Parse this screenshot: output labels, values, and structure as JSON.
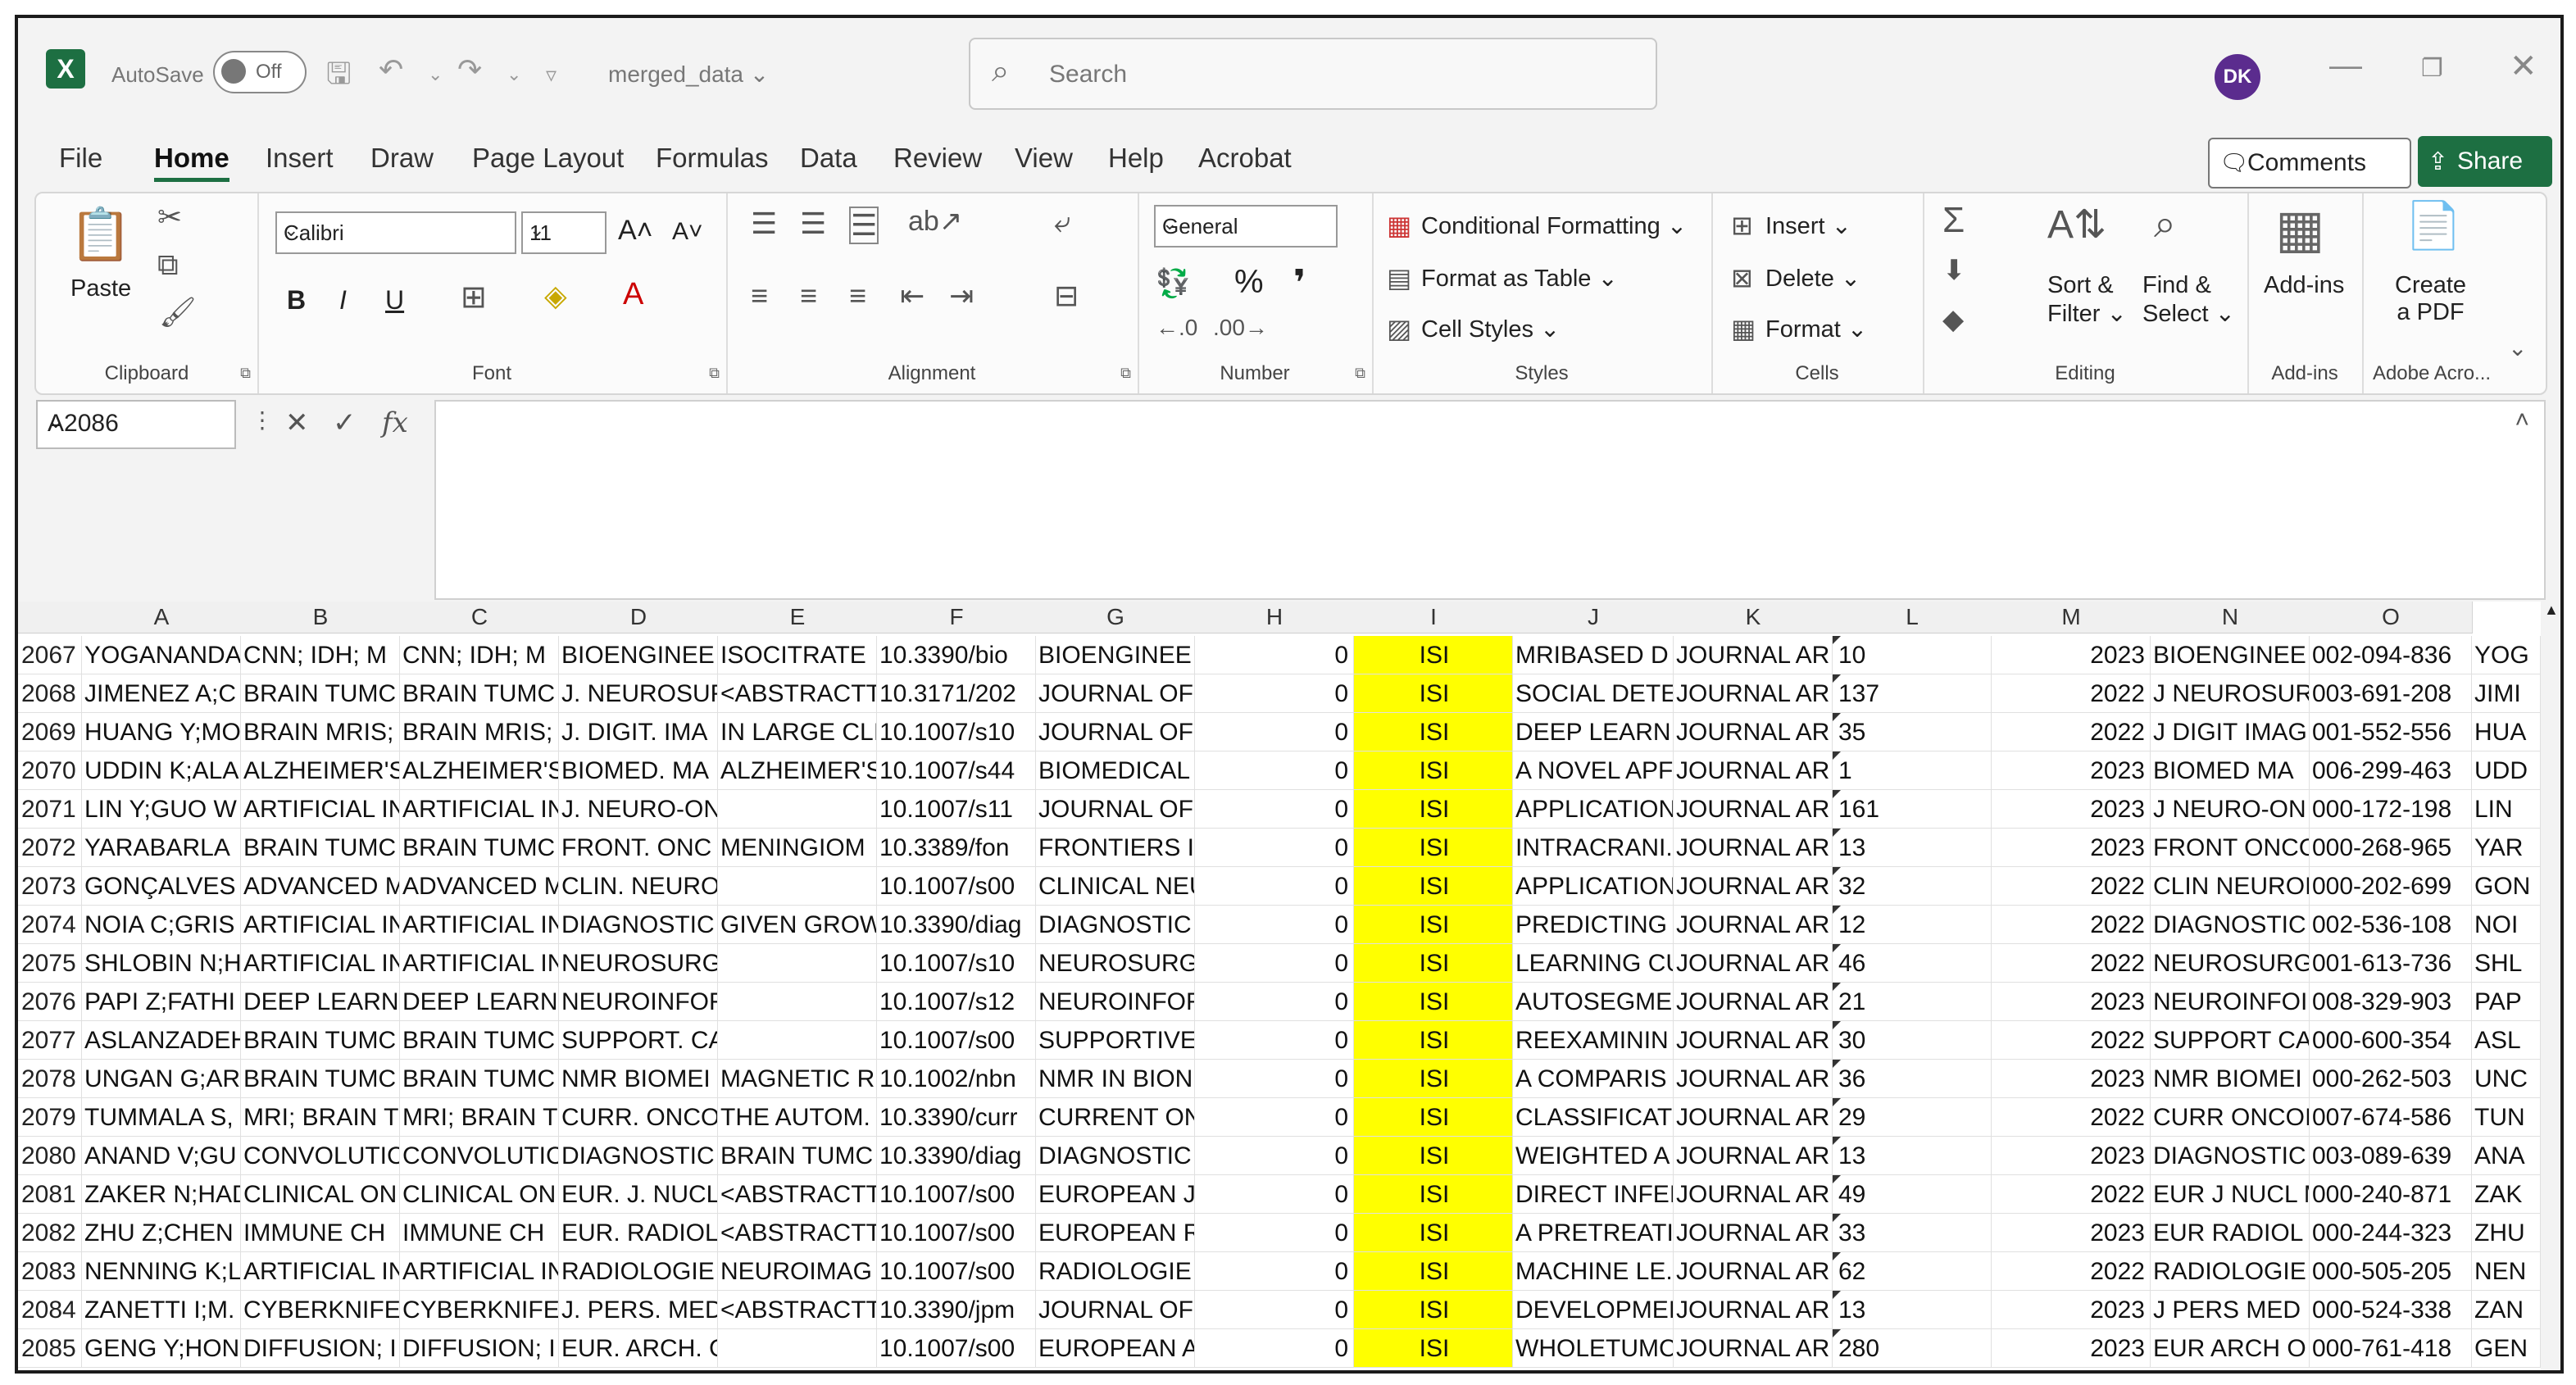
{
  "titlebar": {
    "app_icon": "X",
    "autosave_label": "AutoSave",
    "autosave_state": "Off",
    "document_name": "merged_data",
    "search_placeholder": "Search",
    "user_initials": "DK"
  },
  "menu": {
    "tabs": [
      "File",
      "Home",
      "Insert",
      "Draw",
      "Page Layout",
      "Formulas",
      "Data",
      "Review",
      "View",
      "Help",
      "Acrobat"
    ],
    "active": "Home",
    "comments_label": "Comments",
    "share_label": "Share"
  },
  "ribbon": {
    "clipboard": {
      "paste": "Paste",
      "label": "Clipboard"
    },
    "font": {
      "name": "Calibri",
      "size": "11",
      "label": "Font",
      "bold": "B",
      "italic": "I",
      "underline": "U"
    },
    "alignment": {
      "label": "Alignment"
    },
    "number": {
      "format": "General",
      "percent": "%",
      "comma": "❜",
      "label": "Number"
    },
    "styles": {
      "conditional": "Conditional Formatting",
      "format_table": "Format as Table",
      "cell_styles": "Cell Styles",
      "label": "Styles"
    },
    "cells": {
      "insert": "Insert",
      "delete": "Delete",
      "format": "Format",
      "label": "Cells"
    },
    "editing": {
      "sort_line1": "Sort &",
      "sort_line2": "Filter",
      "find_line1": "Find &",
      "find_line2": "Select",
      "label": "Editing"
    },
    "addins": {
      "name": "Add-ins",
      "label": "Add-ins"
    },
    "adobe": {
      "line1": "Create",
      "line2": "a PDF",
      "label": "Adobe Acro..."
    }
  },
  "formula_bar": {
    "name_box": "A2086",
    "formula": ""
  },
  "columns": [
    "A",
    "B",
    "C",
    "D",
    "E",
    "F",
    "G",
    "H",
    "I",
    "J",
    "K",
    "L",
    "M",
    "N",
    "O"
  ],
  "rows": [
    {
      "n": "2067",
      "A": "YOGANANDA",
      "B": "CNN; IDH; M",
      "C": "CNN; IDH; M",
      "D": "BIOENGINEE",
      "E": "ISOCITRATE",
      "F": "10.3390/bio",
      "G": "BIOENGINEE",
      "H": "0",
      "I": "ISI",
      "J": "MRIBASED D",
      "K": "JOURNAL AR",
      "L": "10",
      "M": "2023",
      "N": "BIOENGINEE",
      "O": "002-094-836",
      "P": "YOG"
    },
    {
      "n": "2068",
      "A": "JIMENEZ A;C",
      "B": "BRAIN TUMC",
      "C": "BRAIN TUMC",
      "D": "J. NEUROSUF",
      "E": "<ABSTRACTT",
      "F": "10.3171/202",
      "G": "JOURNAL OF",
      "H": "0",
      "I": "ISI",
      "J": "SOCIAL DETE",
      "K": "JOURNAL AR",
      "L": "137",
      "M": "2022",
      "N": "J NEUROSUR",
      "O": "003-691-208",
      "P": "JIMI"
    },
    {
      "n": "2069",
      "A": "HUANG Y;MO",
      "B": "BRAIN MRIS;",
      "C": "BRAIN MRIS;",
      "D": "J. DIGIT. IMA",
      "E": "IN LARGE CLI",
      "F": "10.1007/s10",
      "G": "JOURNAL OF",
      "H": "0",
      "I": "ISI",
      "J": "DEEP LEARNI",
      "K": "JOURNAL AR",
      "L": "35",
      "M": "2022",
      "N": "J DIGIT IMAG",
      "O": "001-552-556",
      "P": "HUA"
    },
    {
      "n": "2070",
      "A": "UDDIN K;ALA",
      "B": "ALZHEIMER'S",
      "C": "ALZHEIMER'S",
      "D": "BIOMED. MA",
      "E": "ALZHEIMER'S",
      "F": "10.1007/s44",
      "G": "BIOMEDICAL",
      "H": "0",
      "I": "ISI",
      "J": "A NOVEL APF",
      "K": "JOURNAL AR",
      "L": "1",
      "M": "2023",
      "N": "BIOMED MA",
      "O": "006-299-463",
      "P": "UDD"
    },
    {
      "n": "2071",
      "A": "LIN Y;GUO W",
      "B": "ARTIFICIAL IN",
      "C": "ARTIFICIAL IN",
      "D": "J. NEURO-ON",
      "E": "",
      "F": "10.1007/s11",
      "G": "JOURNAL OF",
      "H": "0",
      "I": "ISI",
      "J": "APPLICATION",
      "K": "JOURNAL AR",
      "L": "161",
      "M": "2023",
      "N": "J NEURO-ON",
      "O": "000-172-198",
      "P": "LIN"
    },
    {
      "n": "2072",
      "A": "YARABARLA",
      "B": "BRAIN TUMC",
      "C": "BRAIN TUMC",
      "D": "FRONT. ONC",
      "E": "MENINGIOM",
      "F": "10.3389/fon",
      "G": "FRONTIERS II",
      "H": "0",
      "I": "ISI",
      "J": "INTRACRANI.",
      "K": "JOURNAL AR",
      "L": "13",
      "M": "2023",
      "N": "FRONT ONCC",
      "O": "000-268-965",
      "P": "YAR"
    },
    {
      "n": "2073",
      "A": "GONÇALVES",
      "B": "ADVANCED M",
      "C": "ADVANCED M",
      "D": "CLIN. NEURO",
      "E": "",
      "F": "10.1007/s00",
      "G": "CLINICAL NEU",
      "H": "0",
      "I": "ISI",
      "J": "APPLICATION",
      "K": "JOURNAL AR",
      "L": "32",
      "M": "2022",
      "N": "CLIN NEUROI",
      "O": "000-202-699",
      "P": "GON"
    },
    {
      "n": "2074",
      "A": "NOIA C;GRIS",
      "B": "ARTIFICIAL IN",
      "C": "ARTIFICIAL IN",
      "D": "DIAGNOSTIC",
      "E": "GIVEN GROW",
      "F": "10.3390/diag",
      "G": "DIAGNOSTIC",
      "H": "0",
      "I": "ISI",
      "J": "PREDICTING",
      "K": "JOURNAL AR",
      "L": "12",
      "M": "2022",
      "N": "DIAGNOSTIC",
      "O": "002-536-108",
      "P": "NOI"
    },
    {
      "n": "2075",
      "A": "SHLOBIN N;H",
      "B": "ARTIFICIAL IN",
      "C": "ARTIFICIAL IN",
      "D": "NEUROSURG",
      "E": "",
      "F": "10.1007/s10",
      "G": "NEUROSURG",
      "H": "0",
      "I": "ISI",
      "J": "LEARNING CU",
      "K": "JOURNAL AR",
      "L": "46",
      "M": "2022",
      "N": "NEUROSURG",
      "O": "001-613-736",
      "P": "SHL"
    },
    {
      "n": "2076",
      "A": "PAPI Z;FATHI",
      "B": "DEEP LEARNI",
      "C": "DEEP LEARNI",
      "D": "NEUROINFOR",
      "E": "",
      "F": "10.1007/s12",
      "G": "NEUROINFOR",
      "H": "0",
      "I": "ISI",
      "J": "AUTOSEGME",
      "K": "JOURNAL AR",
      "L": "21",
      "M": "2023",
      "N": "NEUROINFOI",
      "O": "008-329-903",
      "P": "PAP"
    },
    {
      "n": "2077",
      "A": "ASLANZADEH",
      "B": "BRAIN TUMC",
      "C": "BRAIN TUMC",
      "D": "SUPPORT. CA",
      "E": "",
      "F": "10.1007/s00",
      "G": "SUPPORTIVE",
      "H": "0",
      "I": "ISI",
      "J": "REEXAMININ",
      "K": "JOURNAL AR",
      "L": "30",
      "M": "2022",
      "N": "SUPPORT CA",
      "O": "000-600-354",
      "P": "ASL"
    },
    {
      "n": "2078",
      "A": "UNGAN G;AR",
      "B": "BRAIN TUMC",
      "C": "BRAIN TUMC",
      "D": "NMR BIOMEI",
      "E": "MAGNETIC R",
      "F": "10.1002/nbn",
      "G": "NMR IN BION",
      "H": "0",
      "I": "ISI",
      "J": "A COMPARIS",
      "K": "JOURNAL AR",
      "L": "36",
      "M": "2023",
      "N": "NMR BIOMEI",
      "O": "000-262-503",
      "P": "UNC"
    },
    {
      "n": "2079",
      "A": "TUMMALA S,",
      "B": "MRI; BRAIN T",
      "C": "MRI; BRAIN T",
      "D": "CURR. ONCO",
      "E": "THE AUTOM.",
      "F": "10.3390/curr",
      "G": "CURRENT ON",
      "H": "0",
      "I": "ISI",
      "J": "CLASSIFICATI",
      "K": "JOURNAL AR",
      "L": "29",
      "M": "2022",
      "N": "CURR ONCOI",
      "O": "007-674-586",
      "P": "TUN"
    },
    {
      "n": "2080",
      "A": "ANAND V;GU",
      "B": "CONVOLUTIC",
      "C": "CONVOLUTIC",
      "D": "DIAGNOSTIC",
      "E": "BRAIN TUMC",
      "F": "10.3390/diag",
      "G": "DIAGNOSTIC",
      "H": "0",
      "I": "ISI",
      "J": "WEIGHTED A",
      "K": "JOURNAL AR",
      "L": "13",
      "M": "2023",
      "N": "DIAGNOSTIC",
      "O": "003-089-639",
      "P": "ANA"
    },
    {
      "n": "2081",
      "A": "ZAKER N;HAD",
      "B": "CLINICAL ON",
      "C": "CLINICAL ON",
      "D": "EUR. J. NUCL",
      "E": "<ABSTRACTT",
      "F": "10.1007/s00",
      "G": "EUROPEAN JC",
      "H": "0",
      "I": "ISI",
      "J": "DIRECT INFEI",
      "K": "JOURNAL AR",
      "L": "49",
      "M": "2022",
      "N": "EUR J NUCL M",
      "O": "000-240-871",
      "P": "ZAK"
    },
    {
      "n": "2082",
      "A": "ZHU Z;CHEN",
      "B": "IMMUNE CH",
      "C": "IMMUNE CH",
      "D": "EUR. RADIOL",
      "E": "<ABSTRACTT",
      "F": "10.1007/s00",
      "G": "EUROPEAN R",
      "H": "0",
      "I": "ISI",
      "J": "A PRETREATI",
      "K": "JOURNAL AR",
      "L": "33",
      "M": "2023",
      "N": "EUR RADIOL",
      "O": "000-244-323",
      "P": "ZHU"
    },
    {
      "n": "2083",
      "A": "NENNING K;L",
      "B": "ARTIFICIAL IN",
      "C": "ARTIFICIAL IN",
      "D": "RADIOLOGIE",
      "E": "NEUROIMAG",
      "F": "10.1007/s00",
      "G": "RADIOLOGIE",
      "H": "0",
      "I": "ISI",
      "J": "MACHINE LE.",
      "K": "JOURNAL AR",
      "L": "62",
      "M": "2022",
      "N": "RADIOLOGIE",
      "O": "000-505-205",
      "P": "NEN"
    },
    {
      "n": "2084",
      "A": "ZANETTI I;M.",
      "B": "CYBERKNIFE;",
      "C": "CYBERKNIFE;",
      "D": "J. PERS. MED",
      "E": "<ABSTRACTT",
      "F": "10.3390/jpm",
      "G": "JOURNAL OF",
      "H": "0",
      "I": "ISI",
      "J": "DEVELOPMEI",
      "K": "JOURNAL AR",
      "L": "13",
      "M": "2023",
      "N": "J PERS MED",
      "O": "000-524-338",
      "P": "ZAN"
    },
    {
      "n": "2085",
      "A": "GENG Y;HON",
      "B": "DIFFUSION; I",
      "C": "DIFFUSION; I",
      "D": "EUR. ARCH. C",
      "E": "",
      "F": "10.1007/s00",
      "G": "EUROPEAN A",
      "H": "0",
      "I": "ISI",
      "J": "WHOLETUMC",
      "K": "JOURNAL AR",
      "L": "280",
      "M": "2023",
      "N": "EUR ARCH O",
      "O": "000-761-418",
      "P": "GEN"
    }
  ],
  "colors": {
    "highlight": "#ffff00",
    "accent": "#1d6f42",
    "avatar": "#5b2c8e"
  }
}
